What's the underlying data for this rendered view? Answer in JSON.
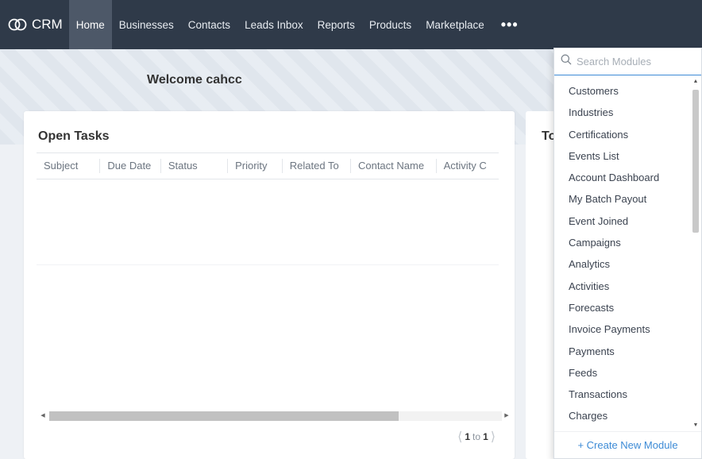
{
  "app": {
    "name": "CRM"
  },
  "nav": {
    "items": [
      {
        "label": "Home",
        "active": true
      },
      {
        "label": "Businesses"
      },
      {
        "label": "Contacts"
      },
      {
        "label": "Leads Inbox"
      },
      {
        "label": "Reports"
      },
      {
        "label": "Products"
      },
      {
        "label": "Marketplace"
      }
    ],
    "more_label": "•••"
  },
  "welcome": "Welcome cahcc",
  "open_tasks": {
    "title": "Open Tasks",
    "columns": [
      "Subject",
      "Due Date",
      "Status",
      "Priority",
      "Related To",
      "Contact Name",
      "Activity C"
    ],
    "pager": {
      "from": "1",
      "to_word": "to",
      "to": "1"
    }
  },
  "side_card": {
    "title": "To"
  },
  "modules_dropdown": {
    "search_placeholder": "Search Modules",
    "items": [
      "Customers",
      "Industries",
      "Certifications",
      "Events List",
      "Account Dashboard",
      "My Batch Payout",
      "Event Joined",
      "Campaigns",
      "Analytics",
      "Activities",
      "Forecasts",
      "Invoice Payments",
      "Payments",
      "Feeds",
      "Transactions",
      "Charges"
    ],
    "create_label": "+ Create New Module"
  },
  "colors": {
    "topbar": "#2f3a49",
    "active_nav": "#4d5868",
    "link_blue": "#3d8bd6"
  }
}
